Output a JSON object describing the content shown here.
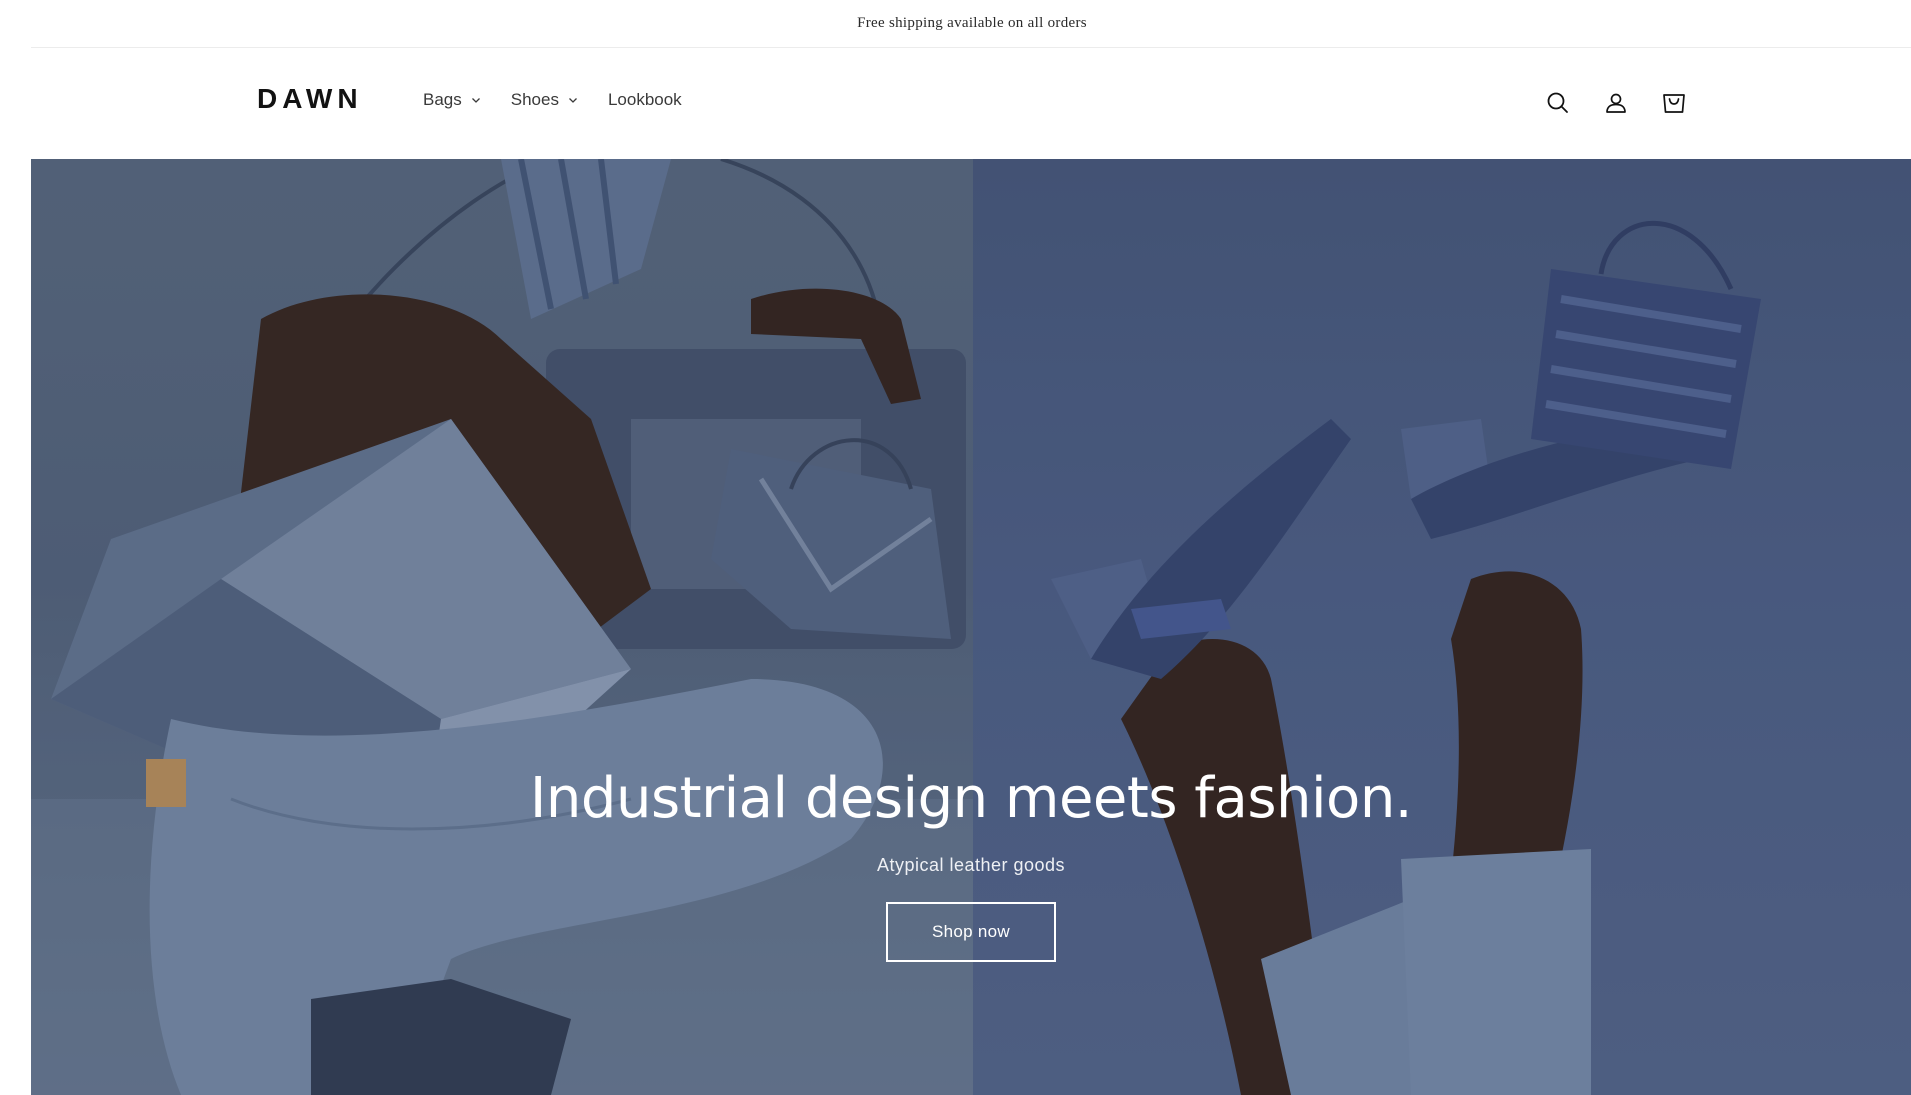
{
  "announcement": {
    "text": "Free shipping available on all orders"
  },
  "header": {
    "logo": "DAWN",
    "nav": [
      {
        "label": "Bags",
        "has_dropdown": true
      },
      {
        "label": "Shoes",
        "has_dropdown": true
      },
      {
        "label": "Lookbook",
        "has_dropdown": false
      }
    ],
    "icons": [
      "search-icon",
      "account-icon",
      "cart-icon"
    ]
  },
  "hero": {
    "title": "Industrial design meets fashion.",
    "subtitle": "Atypical leather goods",
    "button_label": "Shop now"
  },
  "colors": {
    "text": "#121212",
    "hero_left_bg": "#5f7088",
    "hero_right_bg": "#4d5f84",
    "hero_text": "#ffffff"
  }
}
